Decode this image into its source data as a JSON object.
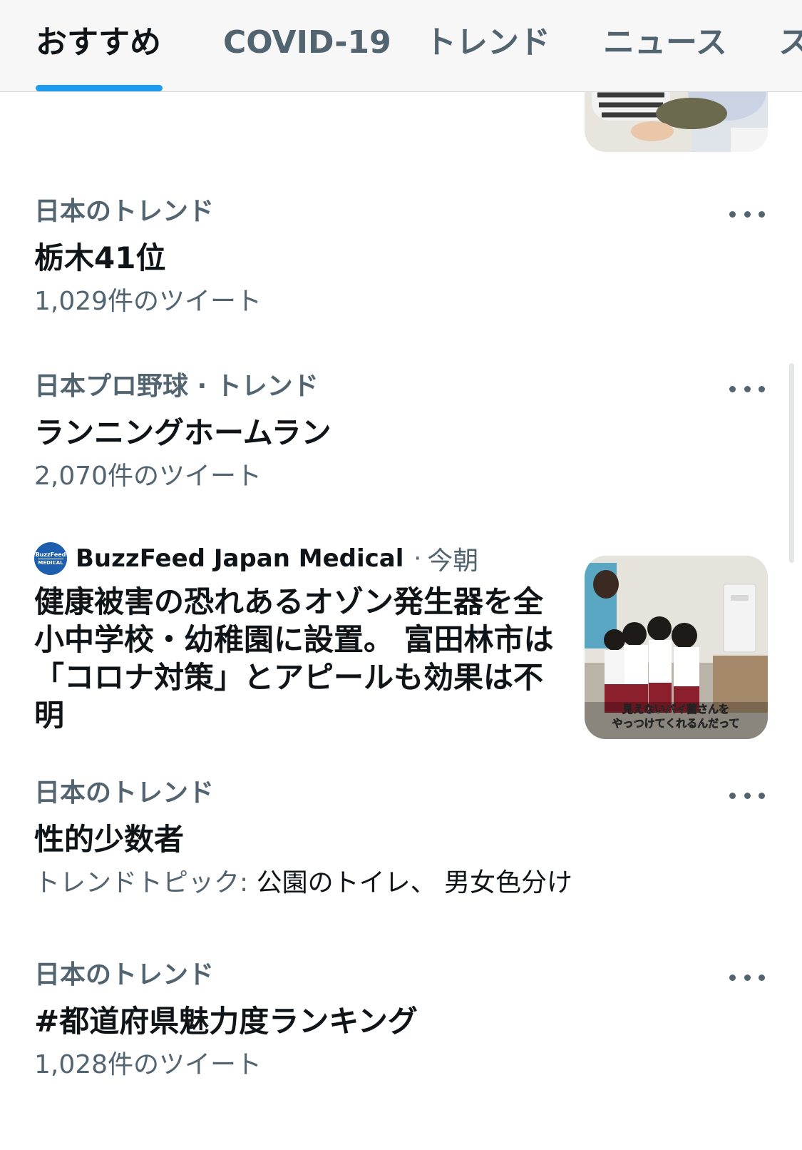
{
  "tabs": [
    {
      "label": "おすすめ",
      "active": true
    },
    {
      "label": "COVID-19",
      "active": false
    },
    {
      "label": "トレンド",
      "active": false
    },
    {
      "label": "ニュース",
      "active": false
    },
    {
      "label": "ス",
      "active": false
    }
  ],
  "trends": [
    {
      "context": "日本のトレンド",
      "title": "栃木41位",
      "meta": "1,029件のツイート"
    },
    {
      "context": "日本プロ野球 · トレンド",
      "title": "ランニングホームラン",
      "meta": "2,070件のツイート"
    },
    {
      "context": "日本のトレンド",
      "title": "性的少数者",
      "meta_label": "トレンドトピック:",
      "meta_topics": "公園のトイレ、 男女色分け"
    },
    {
      "context": "日本のトレンド",
      "title": "#都道府県魅力度ランキング",
      "meta": "1,028件のツイート"
    }
  ],
  "news": {
    "avatar_text_1": "BuzzFeed",
    "avatar_text_2": "MEDICAL",
    "source": "BuzzFeed Japan Medical",
    "separator": "·",
    "time": "今朝",
    "headline": "健康被害の恐れあるオゾン発生器を全小中学校・幼稚園に設置。 富田林市は「コロナ対策」とアピールも効果は不明",
    "image_caption_1": "見えないバイ菌さんを",
    "image_caption_2": "やっつけてくれるんだって"
  },
  "colors": {
    "accent": "#1d9bf0",
    "primary_text": "#0f1419",
    "secondary_text": "#536471",
    "tab_bar_bg": "#f7f7f7"
  },
  "icons": {
    "more": "more-horizontal-icon"
  }
}
